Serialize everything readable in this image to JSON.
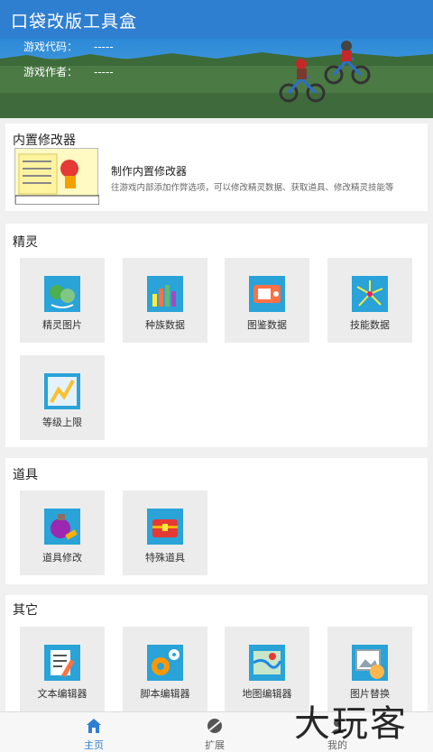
{
  "app": {
    "title": "口袋改版工具盒"
  },
  "banner": {
    "code_label": "游戏代码：",
    "code_value": "-----",
    "author_label": "游戏作者：",
    "author_value": "-----"
  },
  "builtin": {
    "section_title": "内置修改器",
    "item_title": "制作内置修改器",
    "item_desc": "往游戏内部添加作弊选项，可以修改精灵数据、获取道具、修改精灵技能等"
  },
  "sprite": {
    "section_title": "精灵",
    "items": [
      {
        "label": "精灵图片",
        "icon": "sprite-image-icon"
      },
      {
        "label": "种族数据",
        "icon": "bar-chart-icon"
      },
      {
        "label": "图鉴数据",
        "icon": "pokedex-icon"
      },
      {
        "label": "技能数据",
        "icon": "firework-icon"
      },
      {
        "label": "等级上限",
        "icon": "level-cap-icon"
      }
    ]
  },
  "items": {
    "section_title": "道具",
    "items": [
      {
        "label": "道具修改",
        "icon": "potion-icon"
      },
      {
        "label": "特殊道具",
        "icon": "treasure-chest-icon"
      }
    ]
  },
  "other": {
    "section_title": "其它",
    "items": [
      {
        "label": "文本编辑器",
        "icon": "text-edit-icon"
      },
      {
        "label": "脚本编辑器",
        "icon": "gears-icon"
      },
      {
        "label": "地图编辑器",
        "icon": "map-icon"
      },
      {
        "label": "图片替换",
        "icon": "image-replace-icon"
      }
    ]
  },
  "nav": {
    "items": [
      {
        "label": "主页",
        "icon": "home-icon",
        "active": true
      },
      {
        "label": "扩展",
        "icon": "extension-icon",
        "active": false
      },
      {
        "label": "我的",
        "icon": "user-icon",
        "active": false
      }
    ]
  },
  "watermark": {
    "text": "大玩客"
  }
}
